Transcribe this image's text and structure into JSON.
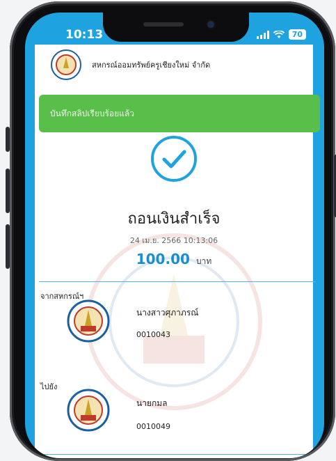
{
  "status_bar": {
    "time": "10:13",
    "battery": "70"
  },
  "header": {
    "coop_name": "สหกรณ์ออมทรัพย์ครูเชียงใหม่ จำกัด"
  },
  "toast": {
    "message": "บันทึกสลิปเรียบร้อยแล้ว"
  },
  "result": {
    "title": "ถอนเงินสำเร็จ",
    "datetime": "24 เม.ย. 2566 10:13:06",
    "amount": "100.00",
    "currency": "บาท"
  },
  "from": {
    "label": "จากสหกรณ์ฯ",
    "name": "นางสาวศุภาภรณ์",
    "account": "0010043"
  },
  "to": {
    "label": "ไปยัง",
    "name": "นายกมล",
    "account": "0010049"
  },
  "colors": {
    "brand": "#1fa3e0",
    "success": "#5abf4a",
    "amount": "#1a8fd0"
  },
  "icons": {
    "check": "check-circle-icon",
    "wifi": "wifi-icon",
    "seal": "coop-seal-logo"
  }
}
